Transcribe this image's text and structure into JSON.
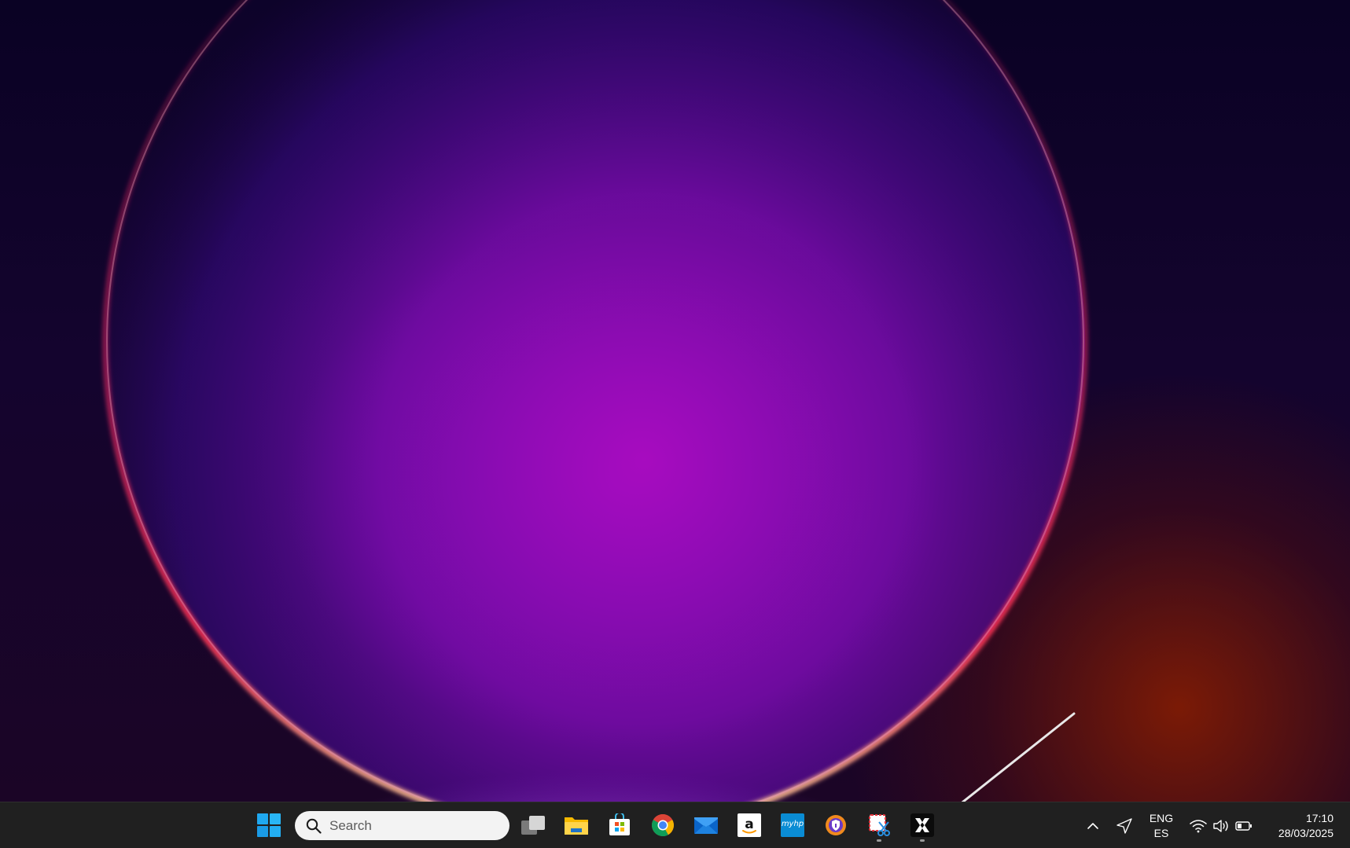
{
  "taskbar": {
    "search": {
      "label": "Search",
      "icon": "search-icon"
    },
    "start": {
      "icon": "windows-logo-icon"
    },
    "apps": [
      {
        "name": "task-view",
        "icon": "task-view-icon",
        "running": false
      },
      {
        "name": "file-explorer",
        "icon": "folder-icon",
        "running": false
      },
      {
        "name": "microsoft-store",
        "icon": "store-icon",
        "running": false
      },
      {
        "name": "chrome",
        "icon": "chrome-icon",
        "running": false
      },
      {
        "name": "mail",
        "icon": "mail-icon",
        "running": false
      },
      {
        "name": "amazon",
        "icon": "amazon-icon",
        "running": false
      },
      {
        "name": "myhp",
        "icon": "myhp-icon",
        "label": "myhp",
        "running": false
      },
      {
        "name": "vpn",
        "icon": "shield-icon",
        "running": false
      },
      {
        "name": "snipping-tool",
        "icon": "snipping-tool-icon",
        "running": true
      },
      {
        "name": "x-app",
        "icon": "x-app-icon",
        "running": true
      }
    ]
  },
  "tray": {
    "show_hidden": {
      "icon": "chevron-up-icon"
    },
    "location": {
      "icon": "location-arrow-icon"
    },
    "language": {
      "line1": "ENG",
      "line2": "ES"
    },
    "wifi": {
      "icon": "wifi-icon"
    },
    "volume": {
      "icon": "volume-icon"
    },
    "battery": {
      "icon": "battery-icon"
    },
    "clock": {
      "time": "17:10",
      "date": "28/03/2025"
    }
  },
  "colors": {
    "taskbar_bg": "#202020",
    "search_bg": "#f3f3f3",
    "accent_blue": "#1fa8f0"
  }
}
